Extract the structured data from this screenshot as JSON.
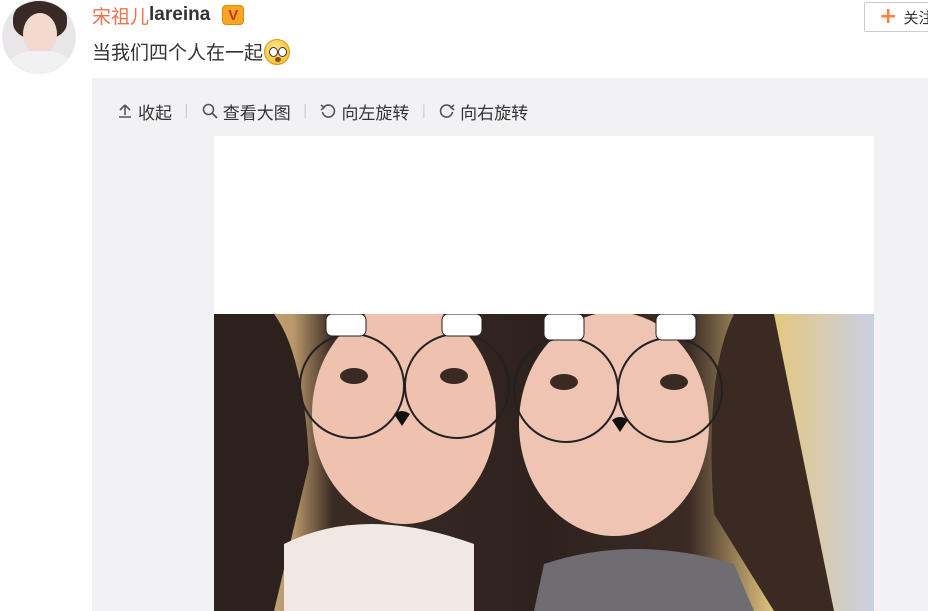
{
  "user": {
    "name_cn": "宋祖儿",
    "name_en": "lareina",
    "verified_badge": "V"
  },
  "follow": {
    "label": "关注"
  },
  "post": {
    "text": "当我们四个人在一起"
  },
  "toolbar": {
    "collapse": "收起",
    "view_large": "查看大图",
    "rotate_left": "向左旋转",
    "rotate_right": "向右旋转"
  },
  "icons": [
    "collapse-up-icon",
    "magnify-icon",
    "rotate-left-icon",
    "rotate-right-icon",
    "plus-icon",
    "thinking-emoji-icon"
  ],
  "colors": {
    "username": "#eb7350",
    "follow_plus": "#ff8140",
    "badge": "#f6a623",
    "panel_bg": "#f2f2f5"
  }
}
